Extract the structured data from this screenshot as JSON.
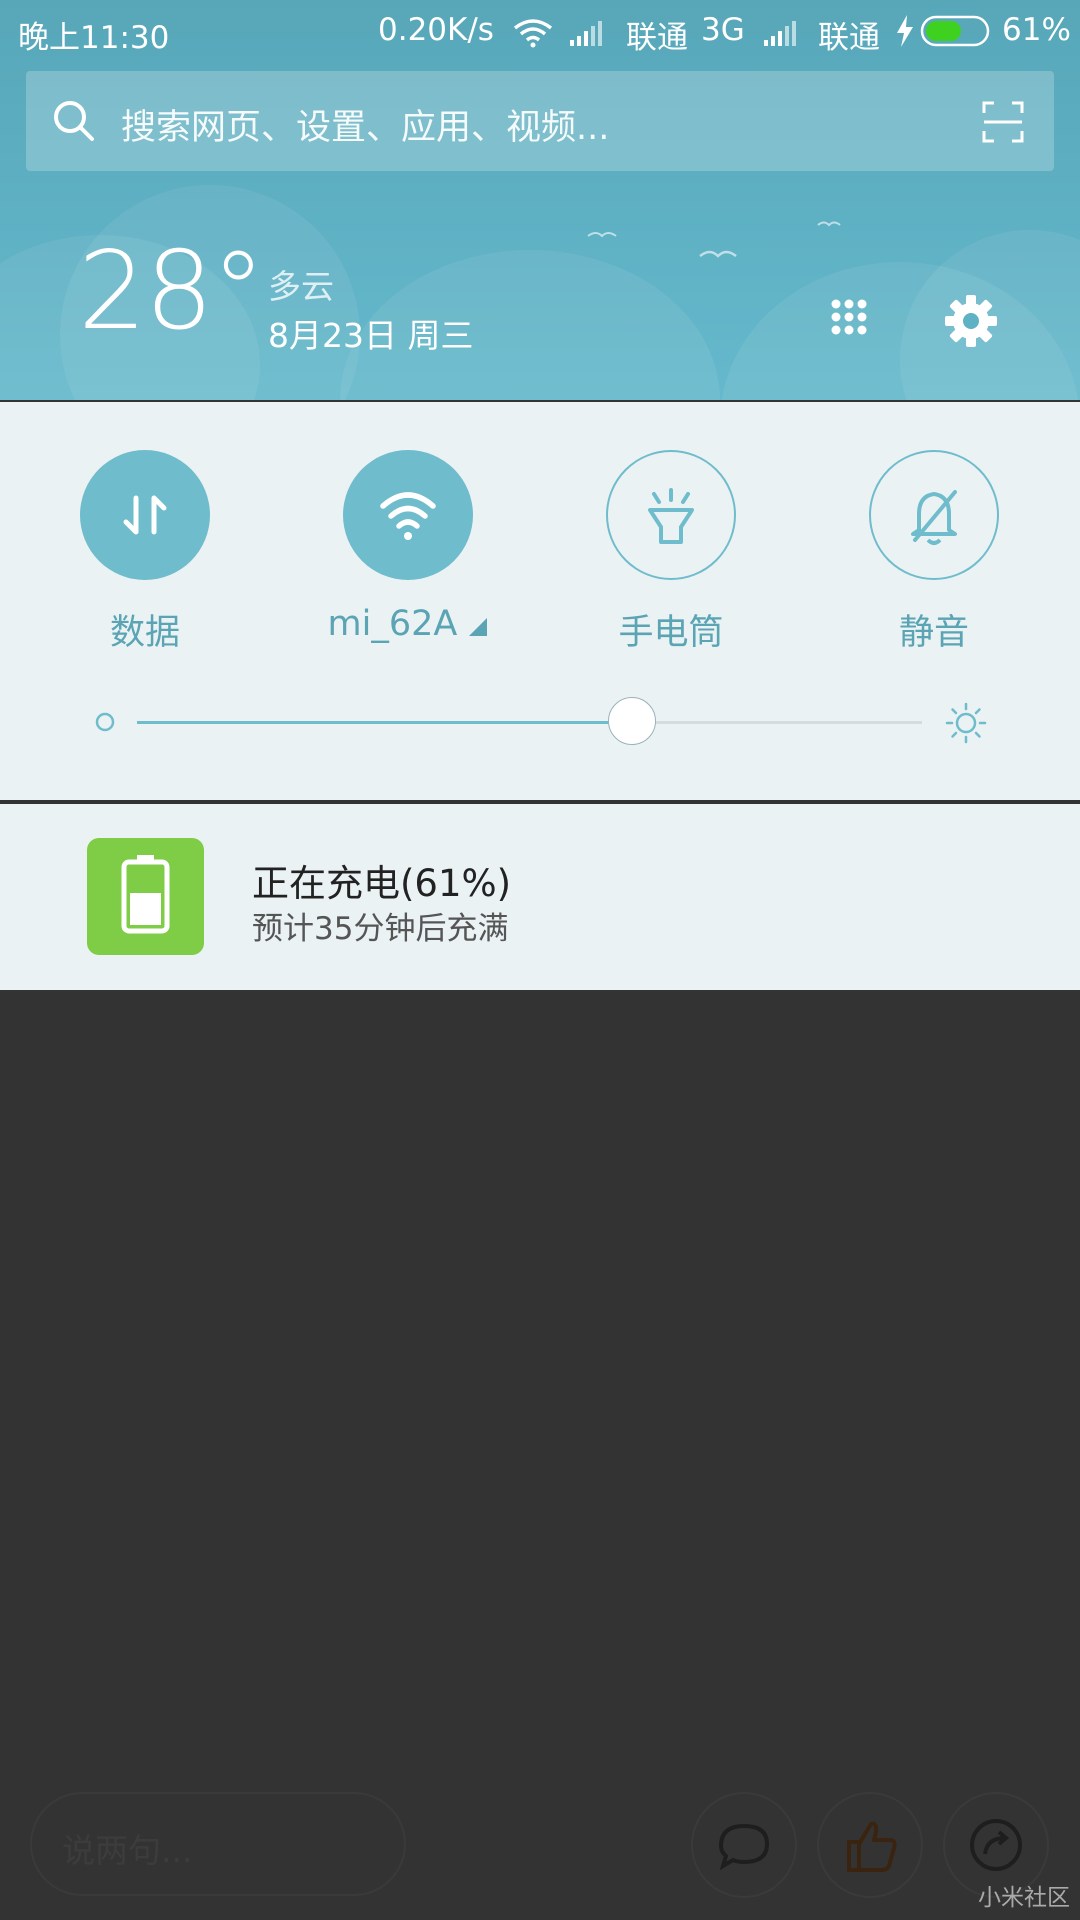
{
  "status_bar": {
    "time": "晚上11:30",
    "net_speed": "0.20K/s",
    "carrier1": "联通",
    "carrier1_type": "3G",
    "carrier2": "联通",
    "battery_text": "61%",
    "battery_level": 0.61
  },
  "search": {
    "placeholder": "搜索网页、设置、应用、视频..."
  },
  "weather": {
    "temperature": "28°",
    "condition": "多云",
    "date": "8月23日 周三"
  },
  "toggles": [
    {
      "label": "数据",
      "icon": "data-arrows-icon",
      "state": "on"
    },
    {
      "label": "mi_62A",
      "icon": "wifi-icon",
      "state": "on"
    },
    {
      "label": "手电筒",
      "icon": "flashlight-icon",
      "state": "off"
    },
    {
      "label": "静音",
      "icon": "bell-mute-icon",
      "state": "off"
    }
  ],
  "brightness": {
    "level": 0.63
  },
  "notification": {
    "title": "正在充电(61%)",
    "subtitle": "预计35分钟后充满",
    "icon": "battery-charging-icon"
  },
  "bottom": {
    "comment_placeholder": "说两句...",
    "watermark": "小米社区"
  },
  "colors": {
    "header": "#5fb1c4",
    "panel": "#eaf2f4",
    "accent": "#6fbccc",
    "battery_green": "#7fcc46",
    "background": "#333333"
  }
}
